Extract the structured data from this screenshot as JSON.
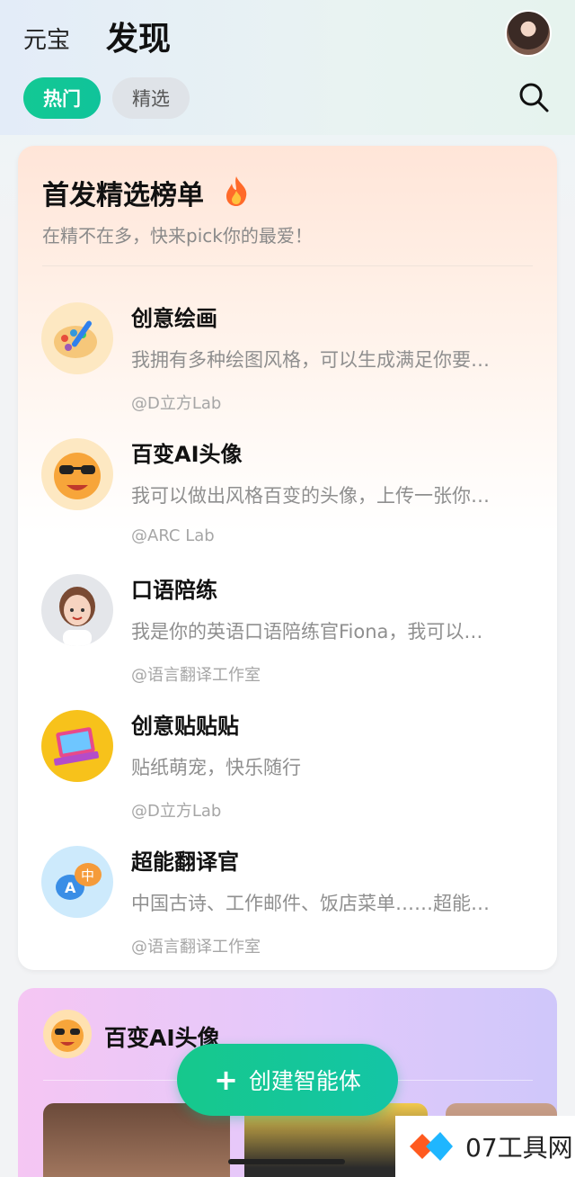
{
  "header": {
    "brand": "元宝",
    "title": "发现",
    "tabs": [
      {
        "label": "热门",
        "active": true
      },
      {
        "label": "精选",
        "active": false
      }
    ]
  },
  "ranking": {
    "title": "首发精选榜单",
    "subtitle": "在精不在多，快来pick你的最爱！",
    "items": [
      {
        "name": "创意绘画",
        "desc": "我拥有多种绘图风格，可以生成满足你要…",
        "author": "@D立方Lab",
        "icon": "palette-icon"
      },
      {
        "name": "百变AI头像",
        "desc": "我可以做出风格百变的头像，上传一张你…",
        "author": "@ARC Lab",
        "icon": "sunglasses-emoji-icon"
      },
      {
        "name": "口语陪练",
        "desc": "我是你的英语口语陪练官Fiona，我可以…",
        "author": "@语言翻译工作室",
        "icon": "girl-avatar-icon"
      },
      {
        "name": "创意贴贴贴",
        "desc": "贴纸萌宠，快乐随行",
        "author": "@D立方Lab",
        "icon": "sticker-laptop-icon"
      },
      {
        "name": "超能翻译官",
        "desc": "中国古诗、工作邮件、饭店菜单……超能…",
        "author": "@语言翻译工作室",
        "icon": "translate-bubble-icon"
      }
    ]
  },
  "featured": {
    "title": "百变AI头像"
  },
  "fab": {
    "label": "创建智能体"
  },
  "watermark": {
    "text": "07工具网"
  },
  "colors": {
    "accent": "#13c994",
    "fire": "#ff6a2a"
  }
}
